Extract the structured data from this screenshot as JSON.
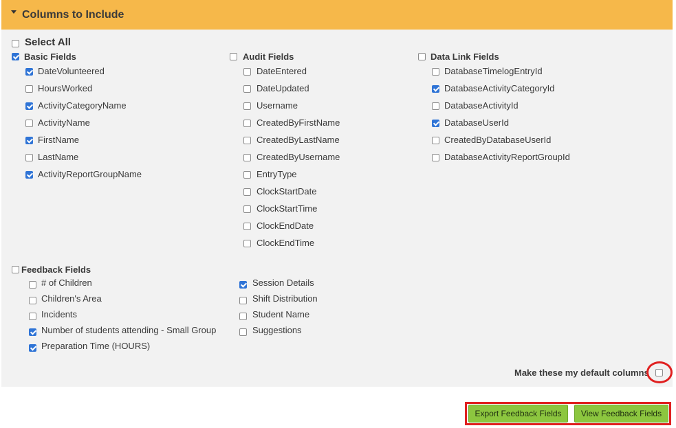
{
  "panel": {
    "title": "Columns to Include"
  },
  "select_all": {
    "label": "Select All",
    "checked": false
  },
  "basic": {
    "label": "Basic Fields",
    "checked": true,
    "items": [
      {
        "label": "DateVolunteered",
        "checked": true
      },
      {
        "label": "HoursWorked",
        "checked": false
      },
      {
        "label": "ActivityCategoryName",
        "checked": true
      },
      {
        "label": "ActivityName",
        "checked": false
      },
      {
        "label": "FirstName",
        "checked": true
      },
      {
        "label": "LastName",
        "checked": false
      },
      {
        "label": "ActivityReportGroupName",
        "checked": true
      }
    ]
  },
  "audit": {
    "label": "Audit Fields",
    "checked": false,
    "items": [
      {
        "label": "DateEntered",
        "checked": false
      },
      {
        "label": "DateUpdated",
        "checked": false
      },
      {
        "label": "Username",
        "checked": false
      },
      {
        "label": "CreatedByFirstName",
        "checked": false
      },
      {
        "label": "CreatedByLastName",
        "checked": false
      },
      {
        "label": "CreatedByUsername",
        "checked": false
      },
      {
        "label": "EntryType",
        "checked": false
      },
      {
        "label": "ClockStartDate",
        "checked": false
      },
      {
        "label": "ClockStartTime",
        "checked": false
      },
      {
        "label": "ClockEndDate",
        "checked": false
      },
      {
        "label": "ClockEndTime",
        "checked": false
      }
    ]
  },
  "datalink": {
    "label": "Data Link Fields",
    "checked": false,
    "items": [
      {
        "label": "DatabaseTimelogEntryId",
        "checked": false
      },
      {
        "label": "DatabaseActivityCategoryId",
        "checked": true
      },
      {
        "label": "DatabaseActivityId",
        "checked": false
      },
      {
        "label": "DatabaseUserId",
        "checked": true
      },
      {
        "label": "CreatedByDatabaseUserId",
        "checked": false
      },
      {
        "label": "DatabaseActivityReportGroupId",
        "checked": false
      }
    ]
  },
  "feedback": {
    "label": "Feedback Fields",
    "checked": false,
    "left_items": [
      {
        "label": "# of Children",
        "checked": false
      },
      {
        "label": "Children's Area",
        "checked": false
      },
      {
        "label": "Incidents",
        "checked": false
      },
      {
        "label": "Number of students attending - Small Group",
        "checked": true
      },
      {
        "label": "Preparation Time (HOURS)",
        "checked": true
      }
    ],
    "right_items": [
      {
        "label": "Session Details",
        "checked": true
      },
      {
        "label": "Shift Distribution",
        "checked": false
      },
      {
        "label": "Student Name",
        "checked": false
      },
      {
        "label": "Suggestions",
        "checked": false
      }
    ]
  },
  "default_columns": {
    "label": "Make these my default columns",
    "checked": false
  },
  "buttons": {
    "export_label": "Export Feedback Fields",
    "view_label": "View Feedback Fields"
  },
  "colors": {
    "header_bg": "#f6b84a",
    "panel_bg": "#f2f2f2",
    "checkbox_checked": "#2f74d6",
    "button_bg": "#8cc63f",
    "highlight": "#e02020"
  }
}
